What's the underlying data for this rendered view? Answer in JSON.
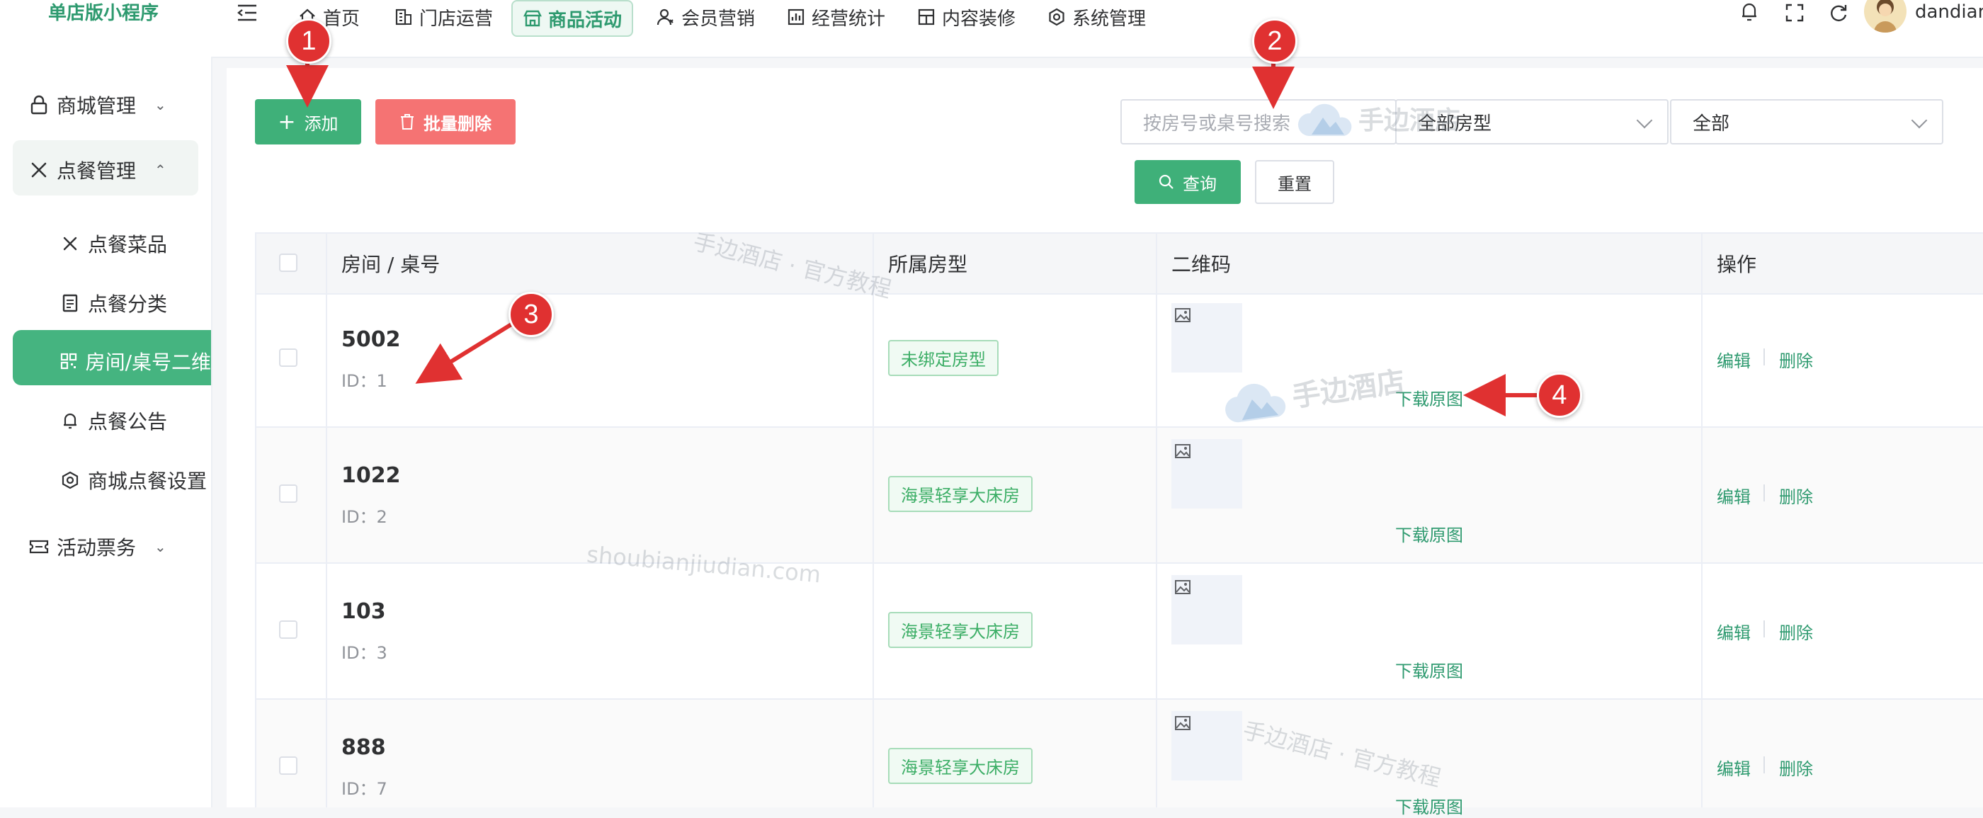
{
  "sidebar": {
    "brand": "单店版小程序",
    "items": [
      {
        "label": "商城管理",
        "icon": "lock-icon"
      },
      {
        "label": "点餐管理",
        "icon": "tools-icon"
      },
      {
        "label": "点餐菜品",
        "icon": "tools-icon"
      },
      {
        "label": "点餐分类",
        "icon": "document-icon"
      },
      {
        "label": "房间/桌号二维",
        "icon": "qrcode-icon"
      },
      {
        "label": "点餐公告",
        "icon": "bell-icon"
      },
      {
        "label": "商城点餐设置",
        "icon": "hexagon-icon"
      },
      {
        "label": "活动票务",
        "icon": "ticket-icon"
      }
    ]
  },
  "topbar": {
    "nav": [
      {
        "label": "首页",
        "icon": "home-icon"
      },
      {
        "label": "门店运营",
        "icon": "building-icon"
      },
      {
        "label": "商品活动",
        "icon": "shop-icon"
      },
      {
        "label": "会员营销",
        "icon": "user-icon"
      },
      {
        "label": "经营统计",
        "icon": "chart-icon"
      },
      {
        "label": "内容装修",
        "icon": "grid-icon"
      },
      {
        "label": "系统管理",
        "icon": "gear-icon"
      }
    ],
    "username": "dandian"
  },
  "toolbar": {
    "add_label": "添加",
    "batch_delete_label": "批量删除",
    "search_placeholder": "按房号或桌号搜索",
    "room_type_value": "全部房型",
    "status_value": "全部",
    "query_label": "查询",
    "reset_label": "重置"
  },
  "table": {
    "headers": [
      "房间 / 桌号",
      "所属房型",
      "二维码",
      "操作"
    ],
    "rows": [
      {
        "room": "5002",
        "id": "ID：1",
        "type": "未绑定房型",
        "download": "下载原图",
        "edit": "编辑",
        "delete": "删除"
      },
      {
        "room": "1022",
        "id": "ID：2",
        "type": "海景轻享大床房",
        "download": "下载原图",
        "edit": "编辑",
        "delete": "删除"
      },
      {
        "room": "103",
        "id": "ID：3",
        "type": "海景轻享大床房",
        "download": "下载原图",
        "edit": "编辑",
        "delete": "删除"
      },
      {
        "room": "888",
        "id": "ID：7",
        "type": "海景轻享大床房",
        "download": "下载原图",
        "edit": "编辑",
        "delete": "删除"
      }
    ]
  },
  "watermarks": [
    "手边酒店 · 官方教程",
    "shoubianjiudian.com",
    "手边酒店",
    "手边酒店",
    "手边酒店 · 官方教程"
  ],
  "markers": [
    "1",
    "2",
    "3",
    "4"
  ],
  "colors": {
    "accent": "#3fb079",
    "danger": "#f57373",
    "annotation": "#e03131"
  }
}
